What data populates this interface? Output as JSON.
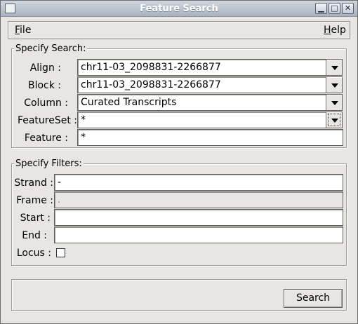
{
  "window": {
    "title": "Feature Search",
    "controls": {
      "minimize": "▁",
      "maximize": "□",
      "close": "✕"
    }
  },
  "menu": {
    "file": {
      "mnemonic": "F",
      "rest": "ile"
    },
    "help": {
      "mnemonic": "H",
      "rest": "elp"
    }
  },
  "search_group": {
    "title": "Specify Search:",
    "align": {
      "label": "Align :",
      "value": "chr11-03_2098831-2266877"
    },
    "block": {
      "label": "Block :",
      "value": "chr11-03_2098831-2266877"
    },
    "column": {
      "label": "Column :",
      "value": "Curated Transcripts"
    },
    "featureset": {
      "label": "FeatureSet :",
      "value": "*"
    },
    "feature": {
      "label": "Feature :",
      "value": "*"
    }
  },
  "filters_group": {
    "title": "Specify Filters:",
    "strand": {
      "label": "Strand :",
      "value": "-"
    },
    "frame": {
      "label": "Frame :",
      "value": "."
    },
    "start": {
      "label": "Start :",
      "value": ""
    },
    "end": {
      "label": "End :",
      "value": ""
    },
    "locus": {
      "label": "Locus :",
      "checked": false
    }
  },
  "actions": {
    "search_label": "Search"
  },
  "colors": {
    "titlebar_top": "#cfd6df",
    "titlebar_bottom": "#a9b3bf",
    "window_bg": "#e8e6e2"
  }
}
